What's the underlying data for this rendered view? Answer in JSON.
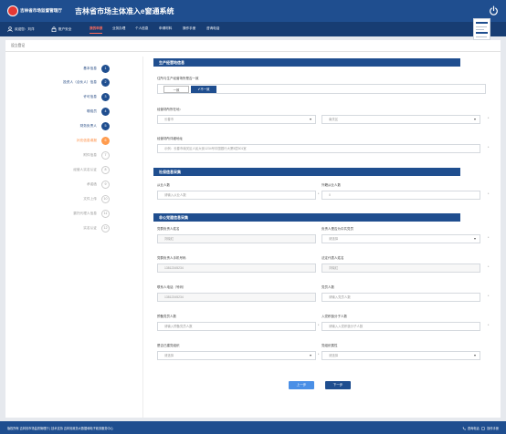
{
  "header": {
    "org_name": "吉林省市场监督管理厅",
    "system_title": "吉林省市场主体准入e窗通系统"
  },
  "nav": {
    "items": [
      {
        "label": "欢迎您：刘洋"
      },
      {
        "label": "账户安全"
      },
      {
        "label": "我的申报"
      },
      {
        "label": "业务办理"
      },
      {
        "label": "个人信息"
      },
      {
        "label": "申请材料"
      },
      {
        "label": "操作手册"
      },
      {
        "label": "咨询电话"
      }
    ]
  },
  "breadcrumb": "设立登记",
  "steps": [
    {
      "num": "1",
      "label": "基本信息"
    },
    {
      "num": "2",
      "label": "投资人（合伙人）信息"
    },
    {
      "num": "3",
      "label": "许可信息"
    },
    {
      "num": "4",
      "label": "联络员"
    },
    {
      "num": "5",
      "label": "财务负责人"
    },
    {
      "num": "6",
      "label": "补充信息填报"
    },
    {
      "num": "7",
      "label": "附件信息"
    },
    {
      "num": "8",
      "label": "经营人实名认证"
    },
    {
      "num": "9",
      "label": "承诺函"
    },
    {
      "num": "10",
      "label": "文件上传"
    },
    {
      "num": "11",
      "label": "委托代理人信息"
    },
    {
      "num": "12",
      "label": "实名认证"
    }
  ],
  "form": {
    "section1": {
      "title": "生产经营地信息",
      "question": "住所与生产经营场所是否一致",
      "toggle_no": "一致",
      "toggle_yes": "✔不一致",
      "region_label": "经营场所所在地：",
      "city_placeholder": "长春市",
      "district_placeholder": "南关区",
      "address_label": "经营场所详细地址",
      "address_placeholder": "示例：长春市南关区人民大街1234号中国银行大厦5层501室"
    },
    "section2": {
      "title": "社保信息采集",
      "employees_label": "从业人数",
      "employees_placeholder": "请输入从业人数",
      "foreign_label": "外籍从业人数",
      "foreign_placeholder": "0"
    },
    "section3": {
      "title": "非公党建信息采集",
      "contact_name_label": "党群负责人姓名",
      "contact_name_value": "刘晓红",
      "contact_party_label": "负责人是否为中共党员",
      "contact_party_placeholder": "请选择",
      "contact_phone_label": "党群负责人手机号码",
      "contact_phone_value": "13812345234",
      "party_leader_label": "法定代表人姓名",
      "party_leader_value": "刘晓红",
      "liaison_phone_label": "联系人电话（号码）",
      "liaison_phone_value": "13812345234",
      "members_label": "党员人数",
      "members_placeholder": "请输入党员人数",
      "prob_members_label": "预备党员人数",
      "prob_members_placeholder": "请输入预备党员人数",
      "activists_label": "入党积极分子人数",
      "activists_placeholder": "请输入入党积极分子人数",
      "org_built_label": "是否已建党组织",
      "org_built_placeholder": "请选择",
      "org_type_label": "党组织属性",
      "org_type_placeholder": "请选择"
    },
    "buttons": {
      "prev": "上一步",
      "next": "下一步"
    }
  },
  "footer": {
    "copyright": "版权所有 吉林省市场监督管理厅 | 技术支持 吉林省政务大数据和电子政务服务中心",
    "phone": "咨询电话",
    "assistant": "操作手册"
  },
  "colors": {
    "primary": "#1f4e8f",
    "nav": "#173d73",
    "accent": "#ff6b5b",
    "current_step": "#ff9b4d",
    "button_prev": "#4a8fe6"
  }
}
